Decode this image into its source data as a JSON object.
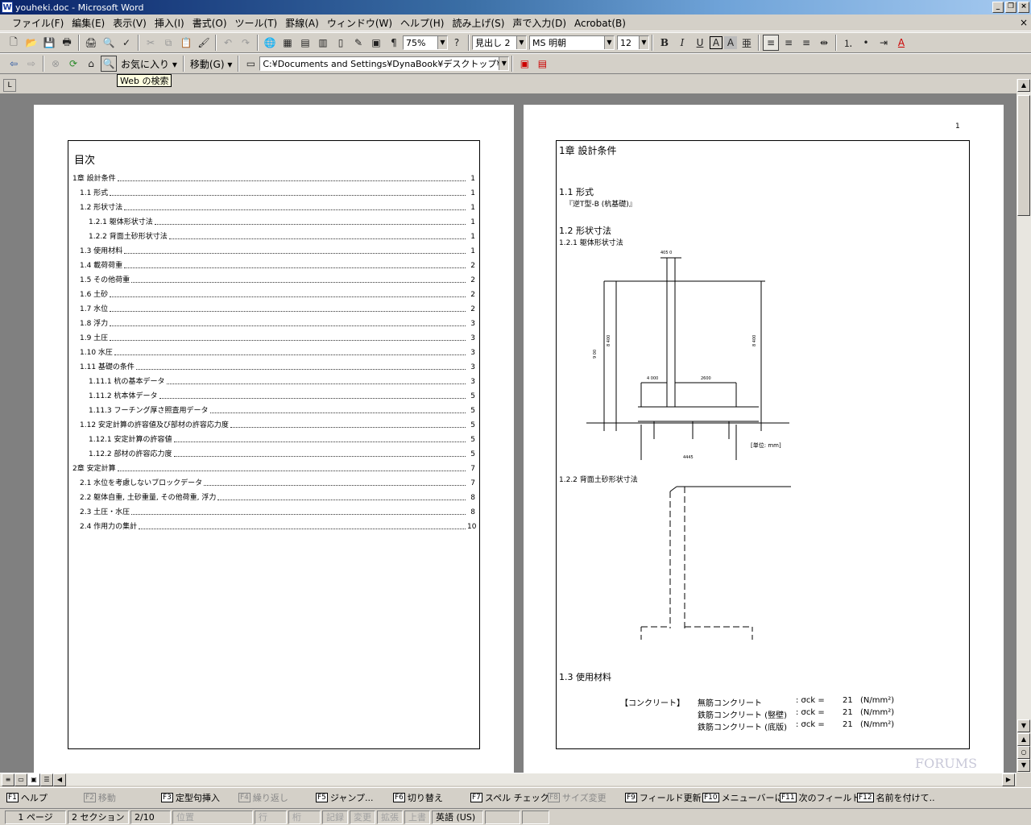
{
  "window": {
    "title": "youheki.doc - Microsoft Word",
    "app_icon": "W"
  },
  "menu": [
    {
      "label": "ファイル(F)"
    },
    {
      "label": "編集(E)"
    },
    {
      "label": "表示(V)"
    },
    {
      "label": "挿入(I)"
    },
    {
      "label": "書式(O)"
    },
    {
      "label": "ツール(T)"
    },
    {
      "label": "罫線(A)"
    },
    {
      "label": "ウィンドウ(W)"
    },
    {
      "label": "ヘルプ(H)"
    },
    {
      "label": "読み上げ(S)"
    },
    {
      "label": "声で入力(D)"
    },
    {
      "label": "Acrobat(B)"
    }
  ],
  "toolbar": {
    "zoom": "75%",
    "style": "見出し 2",
    "font": "MS 明朝",
    "size": "12",
    "bold": "B",
    "italic": "I",
    "underline": "U",
    "charbox": "A",
    "charshade": "A"
  },
  "web_toolbar": {
    "favorites": "お気に入り ▾",
    "go": "移動(G) ▾",
    "address": "C:¥Documents and Settings¥DynaBook¥デスクトップ¥youh"
  },
  "tooltip": "Web の検索",
  "toc": {
    "title": "目次",
    "items": [
      {
        "label": "1章 設計条件",
        "page": "1",
        "level": 0
      },
      {
        "label": "1.1 形式",
        "page": "1",
        "level": 1
      },
      {
        "label": "1.2 形状寸法",
        "page": "1",
        "level": 1
      },
      {
        "label": "1.2.1 躯体形状寸法",
        "page": "1",
        "level": 2
      },
      {
        "label": "1.2.2 背面土砂形状寸法",
        "page": "1",
        "level": 2
      },
      {
        "label": "1.3 使用材料",
        "page": "1",
        "level": 1
      },
      {
        "label": "1.4 載荷荷重",
        "page": "2",
        "level": 1
      },
      {
        "label": "1.5 その他荷重",
        "page": "2",
        "level": 1
      },
      {
        "label": "1.6 土砂",
        "page": "2",
        "level": 1
      },
      {
        "label": "1.7 水位",
        "page": "2",
        "level": 1
      },
      {
        "label": "1.8 浮力",
        "page": "3",
        "level": 1
      },
      {
        "label": "1.9 土圧",
        "page": "3",
        "level": 1
      },
      {
        "label": "1.10 水圧",
        "page": "3",
        "level": 1
      },
      {
        "label": "1.11 基礎の条件",
        "page": "3",
        "level": 1
      },
      {
        "label": "1.11.1 杭の基本データ",
        "page": "3",
        "level": 2
      },
      {
        "label": "1.11.2 杭本体データ",
        "page": "5",
        "level": 2
      },
      {
        "label": "1.11.3 フーチング厚さ照査用データ",
        "page": "5",
        "level": 2
      },
      {
        "label": "1.12 安定計算の許容値及び部材の許容応力度",
        "page": "5",
        "level": 1
      },
      {
        "label": "1.12.1 安定計算の許容値",
        "page": "5",
        "level": 2
      },
      {
        "label": "1.12.2 部材の許容応力度",
        "page": "5",
        "level": 2
      },
      {
        "label": "2章 安定計算",
        "page": "7",
        "level": 0
      },
      {
        "label": "2.1 水位を考慮しないブロックデータ",
        "page": "7",
        "level": 1
      },
      {
        "label": "2.2 躯体自重, 土砂重量, その他荷重, 浮力",
        "page": "8",
        "level": 1
      },
      {
        "label": "2.3 土圧・水圧",
        "page": "8",
        "level": 1
      },
      {
        "label": "2.4 作用力の集計",
        "page": "10",
        "level": 1
      }
    ]
  },
  "page2": {
    "page_number": "1",
    "h_ch1": "1章 設計条件",
    "h_11": "1.1 形式",
    "form_text": "『逆T型-B (杭基礎)』",
    "h_12": "1.2 形状寸法",
    "h_121": "1.2.1 躯体形状寸法",
    "dims": {
      "top": "405 0",
      "left_h": "9 00",
      "h1": "8 400",
      "h2": "8 400",
      "base_l": "4 000",
      "base_r": "2600",
      "width": "4445",
      "unit": "[単位: mm]"
    },
    "h_122": "1.2.2 背面土砂形状寸法",
    "h_13": "1.3 使用材料",
    "materials": {
      "category": "【コンクリート】",
      "rows": [
        {
          "name": "無筋コンクリート",
          "sym": ": σck =",
          "val": "21",
          "unit": "(N/mm²)"
        },
        {
          "name": "鉄筋コンクリート (竪壁)",
          "sym": ": σck =",
          "val": "21",
          "unit": "(N/mm²)"
        },
        {
          "name": "鉄筋コンクリート (底版)",
          "sym": ": σck =",
          "val": "21",
          "unit": "(N/mm²)"
        }
      ]
    },
    "watermark": "FORUMS"
  },
  "fkeys": [
    {
      "key": "F1",
      "label": "ヘルプ",
      "enabled": true
    },
    {
      "key": "F2",
      "label": "移動",
      "enabled": false
    },
    {
      "key": "F3",
      "label": "定型句挿入",
      "enabled": true
    },
    {
      "key": "F4",
      "label": "繰り返し",
      "enabled": false
    },
    {
      "key": "F5",
      "label": "ジャンプ...",
      "enabled": true
    },
    {
      "key": "F6",
      "label": "切り替え",
      "enabled": true
    },
    {
      "key": "F7",
      "label": "スペル チェック...",
      "enabled": true
    },
    {
      "key": "F8",
      "label": "サイズ変更",
      "enabled": false
    },
    {
      "key": "F9",
      "label": "フィールド更新",
      "enabled": true
    },
    {
      "key": "F10",
      "label": "メニューバーに...",
      "enabled": true
    },
    {
      "key": "F11",
      "label": "次のフィールド",
      "enabled": true
    },
    {
      "key": "F12",
      "label": "名前を付けて...",
      "enabled": true
    }
  ],
  "status": {
    "page": "1 ページ",
    "section": "2 セクション",
    "pages": "2/10",
    "pos": "位置",
    "line": "行",
    "col": "桁",
    "rec": "記録",
    "trk": "変更",
    "ext": "拡張",
    "ovr": "上書",
    "lang": "英語 (US)"
  }
}
